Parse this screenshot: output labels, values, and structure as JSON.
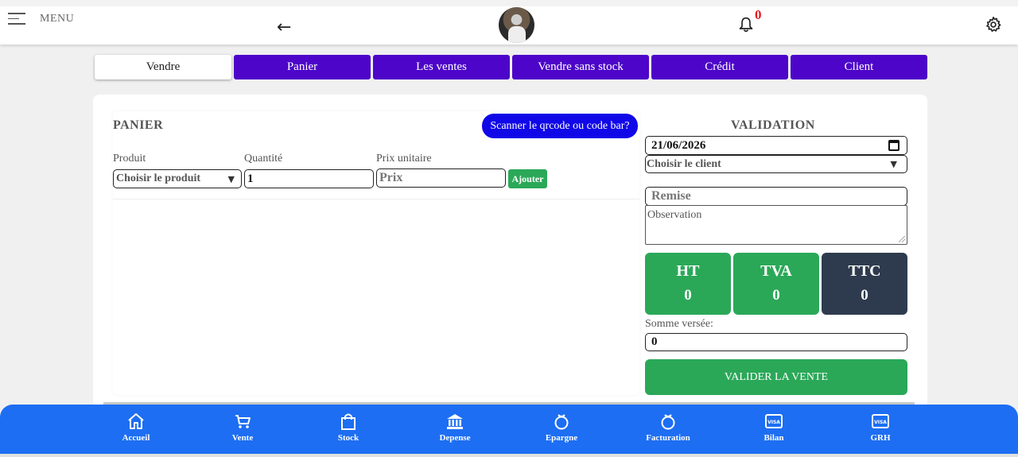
{
  "header": {
    "menu_label": "MENU",
    "back_icon": "arrow-left-icon",
    "notification_count": "0"
  },
  "tabs": [
    {
      "label": "Vendre",
      "active": true
    },
    {
      "label": "Panier"
    },
    {
      "label": "Les ventes"
    },
    {
      "label": "Vendre sans stock"
    },
    {
      "label": "Crédit"
    },
    {
      "label": "Client"
    }
  ],
  "panier": {
    "title": "PANIER",
    "scan_button": "Scanner le qrcode ou code bar?",
    "product_label": "Produit",
    "product_select": "Choisir le produit",
    "quantity_label": "Quantité",
    "quantity_value": "1",
    "price_label": "Prix unitaire",
    "price_placeholder": "Prix",
    "add_button": "Ajouter"
  },
  "validation": {
    "title": "VALIDATION",
    "date": "21/06/2026",
    "client_select": "Choisir le client",
    "remise_placeholder": "Remise",
    "observation_placeholder": "Observation",
    "totals": [
      {
        "label": "HT",
        "value": "0",
        "color": "#2aa858"
      },
      {
        "label": "TVA",
        "value": "0",
        "color": "#2aa858"
      },
      {
        "label": "TTC",
        "value": "0",
        "color": "#2e3b4e"
      }
    ],
    "paid_label": "Somme versée:",
    "paid_value": "0",
    "submit_button": "VALIDER LA VENTE"
  },
  "bottom_nav": [
    {
      "label": "Accueil",
      "icon": "home-icon"
    },
    {
      "label": "Vente",
      "icon": "cart-icon"
    },
    {
      "label": "Stock",
      "icon": "bag-icon"
    },
    {
      "label": "Depense",
      "icon": "bank-icon"
    },
    {
      "label": "Epargne",
      "icon": "apple-icon"
    },
    {
      "label": "Facturation",
      "icon": "apple-icon"
    },
    {
      "label": "Bilan",
      "icon": "visa-card-icon"
    },
    {
      "label": "GRH",
      "icon": "visa-card-icon"
    }
  ],
  "colors": {
    "tab_purple": "#4d05c9",
    "scan_blue": "#1108e8",
    "green": "#2aa858",
    "dark": "#2e3b4e",
    "nav_blue": "#1d6ef2",
    "notification_red": "#e8161b"
  }
}
